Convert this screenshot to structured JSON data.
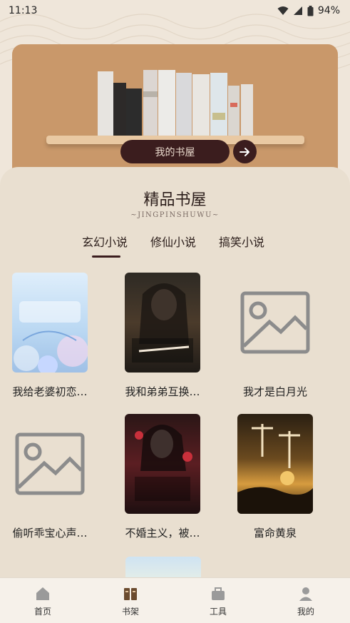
{
  "status_bar": {
    "time": "11:13",
    "battery": "94%"
  },
  "banner": {
    "shelf_label": "我的书屋"
  },
  "section": {
    "title": "精品书屋",
    "subtitle": "~JINGPINSHUWU~"
  },
  "tabs": [
    {
      "label": "玄幻小说",
      "active": true
    },
    {
      "label": "修仙小说",
      "active": false
    },
    {
      "label": "搞笑小说",
      "active": false
    }
  ],
  "books": [
    {
      "title": "我给老婆初恋…",
      "cover": "blue-floral"
    },
    {
      "title": "我和弟弟互换…",
      "cover": "dark-warrior"
    },
    {
      "title": "我才是白月光",
      "cover": "placeholder"
    },
    {
      "title": "偷听乖宝心声…",
      "cover": "placeholder"
    },
    {
      "title": "不婚主义，被…",
      "cover": "dark-lady"
    },
    {
      "title": "富命黄泉",
      "cover": "sunset"
    }
  ],
  "bottom_nav": [
    {
      "label": "首页",
      "icon": "home-icon"
    },
    {
      "label": "书架",
      "icon": "bookshelf-icon",
      "active": true
    },
    {
      "label": "工具",
      "icon": "toolbox-icon"
    },
    {
      "label": "我的",
      "icon": "user-icon"
    }
  ]
}
